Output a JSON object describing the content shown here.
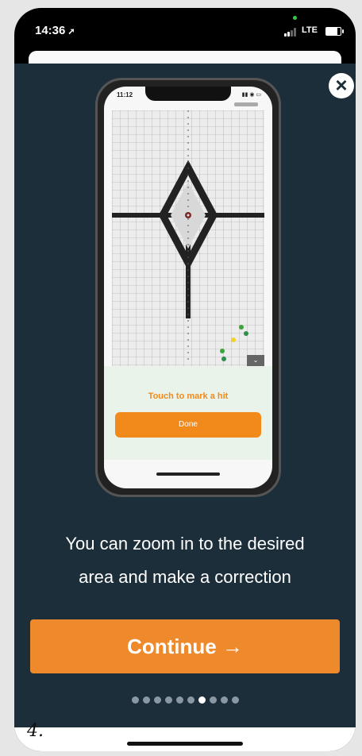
{
  "status_bar": {
    "time": "14:36",
    "carrier": "LTE",
    "battery_level": 0.75
  },
  "tutorial": {
    "close_icon": "close-x-icon",
    "description_line1": "You can zoom in to the desired",
    "description_line2": "area and make a correction",
    "continue_label": "Continue →",
    "page_dots": {
      "total": 10,
      "active_index": 6
    }
  },
  "screenshot_preview": {
    "time": "11:12",
    "hint": "Touch to mark a hit",
    "done_label": "Done"
  },
  "colors": {
    "accent": "#ee8a2c",
    "modal_bg": "#1c2e3a"
  },
  "page_number": "4."
}
